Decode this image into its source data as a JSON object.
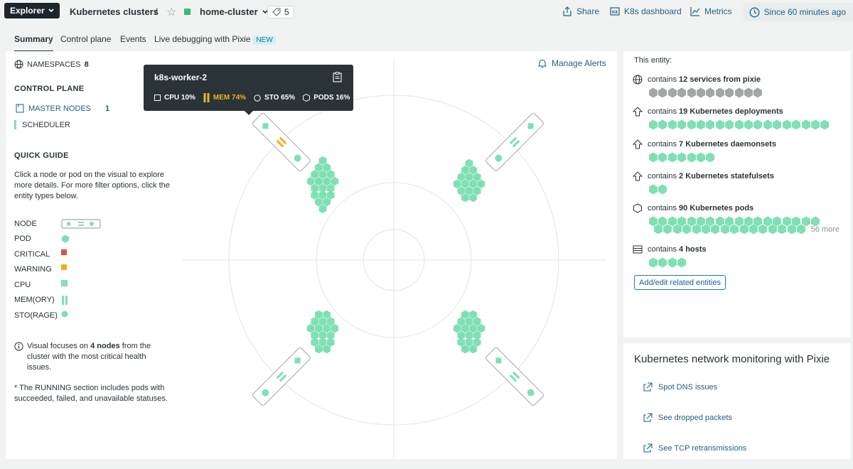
{
  "header": {
    "explorer_label": "Explorer",
    "breadcrumb_parent": "Kubernetes clusters",
    "cluster_name": "home-cluster",
    "tag_count": "5",
    "share_label": "Share",
    "k8s_dashboard_label": "K8s dashboard",
    "metrics_label": "Metrics",
    "time_range_label": "Since 60 minutes ago"
  },
  "tabs": [
    {
      "label": "Summary",
      "active": true
    },
    {
      "label": "Control plane"
    },
    {
      "label": "Events"
    },
    {
      "label": "Live debugging with Pixie",
      "badge": "NEW"
    }
  ],
  "sidebar": {
    "namespaces_label": "NAMESPACES",
    "namespaces_count": "8",
    "control_plane_title": "CONTROL PLANE",
    "master_nodes_label": "MASTER NODES",
    "master_nodes_count": "1",
    "scheduler_label": "SCHEDULER",
    "quick_guide_title": "QUICK GUIDE",
    "quick_guide_text": "Click a node or pod on the visual to explore more details. For more filter options, click the entity types below.",
    "legend": [
      {
        "label": "NODE"
      },
      {
        "label": "POD"
      },
      {
        "label": "CRITICAL"
      },
      {
        "label": "WARNING"
      },
      {
        "label": "CPU"
      },
      {
        "label": "MEM(ORY)"
      },
      {
        "label": "STO(RAGE)"
      }
    ],
    "visual_note_prefix": "Visual focuses on",
    "visual_note_bold": "4 nodes",
    "visual_note_suffix": "from the cluster with the most critical health issues.",
    "running_note": "* The RUNNING section includes pods with succeeded, failed, and unavailable statuses."
  },
  "manage_alerts_label": "Manage Alerts",
  "tooltip": {
    "node_name": "k8s-worker-2",
    "cpu": "CPU 10%",
    "mem": "MEM 74%",
    "sto": "STO 65%",
    "pods": "PODS 16%"
  },
  "entity": {
    "heading": "This entity:",
    "relations": [
      {
        "prefix": "contains",
        "bold": "12 services from pixie",
        "count": 12,
        "status": "gray",
        "icon": "globe-icon"
      },
      {
        "prefix": "contains",
        "bold": "19 Kubernetes deployments",
        "count": 19,
        "status": "healthy",
        "icon": "deploy-arrow-icon"
      },
      {
        "prefix": "contains",
        "bold": "7 Kubernetes daemonsets",
        "count": 7,
        "status": "healthy",
        "icon": "daemonset-arrow-icon"
      },
      {
        "prefix": "contains",
        "bold": "2 Kubernetes statefulsets",
        "count": 2,
        "status": "healthy",
        "icon": "statefulset-arrow-icon"
      },
      {
        "prefix": "contains",
        "bold": "90 Kubernetes pods",
        "count": 90,
        "status": "healthy",
        "icon": "pod-hexagon-icon",
        "more": "56 more"
      },
      {
        "prefix": "contains",
        "bold": "4 hosts",
        "count": 4,
        "status": "healthy",
        "icon": "host-icon"
      }
    ],
    "add_button_label": "Add/edit related entities"
  },
  "network": {
    "title": "Kubernetes network monitoring with Pixie",
    "links": [
      "Spot DNS issues",
      "See dropped packets",
      "See TCP retransmissions"
    ]
  },
  "colors": {
    "healthy": "#7fe0b3",
    "gray": "#a3a7a7",
    "critical": "#df4f4f",
    "warning": "#f2b01e",
    "link": "#1f5f8b"
  }
}
